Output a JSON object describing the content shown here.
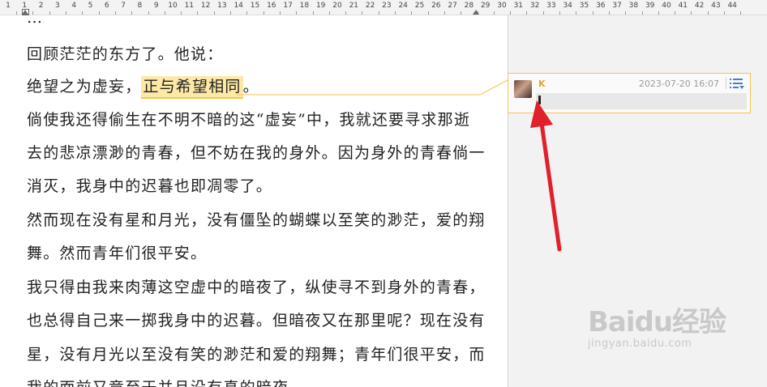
{
  "ruler": {
    "labels": [
      "1",
      "1",
      "2",
      "3",
      "4",
      "5",
      "6",
      "7",
      "8",
      "9",
      "10",
      "11",
      "12",
      "13",
      "14",
      "15",
      "16",
      "17",
      "18",
      "19",
      "20",
      "21",
      "22",
      "23",
      "24",
      "25",
      "26",
      "27",
      "28",
      "29",
      "30",
      "31",
      "32",
      "33",
      "34",
      "35",
      "36",
      "37",
      "38",
      "39",
      "40",
      "41",
      "42",
      "43",
      "44"
    ]
  },
  "document": {
    "line_top": "…",
    "line1": "回顾茫茫的东方了。他说：",
    "line2_before": "绝望之为虚妄，",
    "line2_highlight": "正与希望相同",
    "line2_after": "。",
    "line3": "倘使我还得偷生在不明不暗的这“虚妄”中，我就还要寻求那逝",
    "line4": "去的悲凉漂渺的青春，但不妨在我的身外。因为身外的青春倘一",
    "line5": "消灭，我身中的迟暮也即凋零了。",
    "line6": "然而现在没有星和月光，没有僵坠的蝴蝶以至笑的渺茫，爱的翔",
    "line7": "舞。然而青年们很平安。",
    "line8": "我只得由我来肉薄这空虚中的暗夜了，纵使寻不到身外的青春，",
    "line9": "也总得自己来一掷我身中的迟暮。但暗夜又在那里呢？现在没有",
    "line10": "星，没有月光以至没有笑的渺茫和爱的翔舞；青年们很平安，而",
    "line11": "我的面前又竟至于并且没有真的暗夜。"
  },
  "comment": {
    "author": "K",
    "time": "2023-07-20 16:07",
    "text": "",
    "accent_color": "#f0c650",
    "author_color": "#e3a92a"
  },
  "annotation": {
    "arrow_color": "#e0202a"
  },
  "watermark": {
    "brand": "Baidu经验",
    "url": "jingyan.baidu.com"
  }
}
